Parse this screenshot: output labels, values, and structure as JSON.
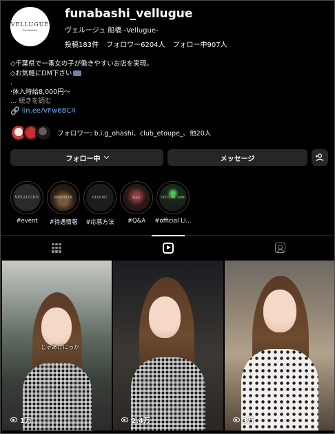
{
  "profile": {
    "avatar_logo": "VELLUGUE",
    "avatar_logo_sub": "Funabashi",
    "username": "funabashi_vellugue",
    "more": "···",
    "full_name": "ヴェルージュ 船橋 -Vellugue-",
    "stats": {
      "posts": "投稿183件",
      "followers": "フォロワー6204人",
      "following": "フォロー中907人"
    }
  },
  "bio": {
    "line1": "◇千葉県で一番女の子が働きやすいお店を実現。",
    "line2": "◇お気軽にDM下さい",
    "line3": ".",
    "line4": "·体入時給8,000円〜",
    "more": "... 続きを読む",
    "link": "lin.ee/VFw6BC4"
  },
  "followed_by": "フォロワー: b.i.g_ohashi、club_etoupe_、他20人",
  "buttons": {
    "follow": "フォロー中",
    "message": "メッセージ"
  },
  "highlights": [
    {
      "label": "#event",
      "cover": "VELLUGUE"
    },
    {
      "label": "#待遇情報",
      "cover": "REPORTER"
    },
    {
      "label": "#応募方法",
      "cover": "RECRUIT"
    },
    {
      "label": "#Q&A",
      "cover": "Q&A"
    },
    {
      "label": "#official LI...",
      "cover": "OFFICIAL LINE"
    }
  ],
  "tabs": [
    {
      "name": "posts",
      "icon": "grid-icon",
      "active": false
    },
    {
      "name": "reels",
      "icon": "reels-icon",
      "active": true
    },
    {
      "name": "tagged",
      "icon": "tagged-icon",
      "active": false
    }
  ],
  "reels": [
    {
      "views": "1万",
      "caption": "じゃあげにっか"
    },
    {
      "views": "2.4万",
      "caption": ""
    },
    {
      "views": "3万",
      "caption": ""
    }
  ]
}
